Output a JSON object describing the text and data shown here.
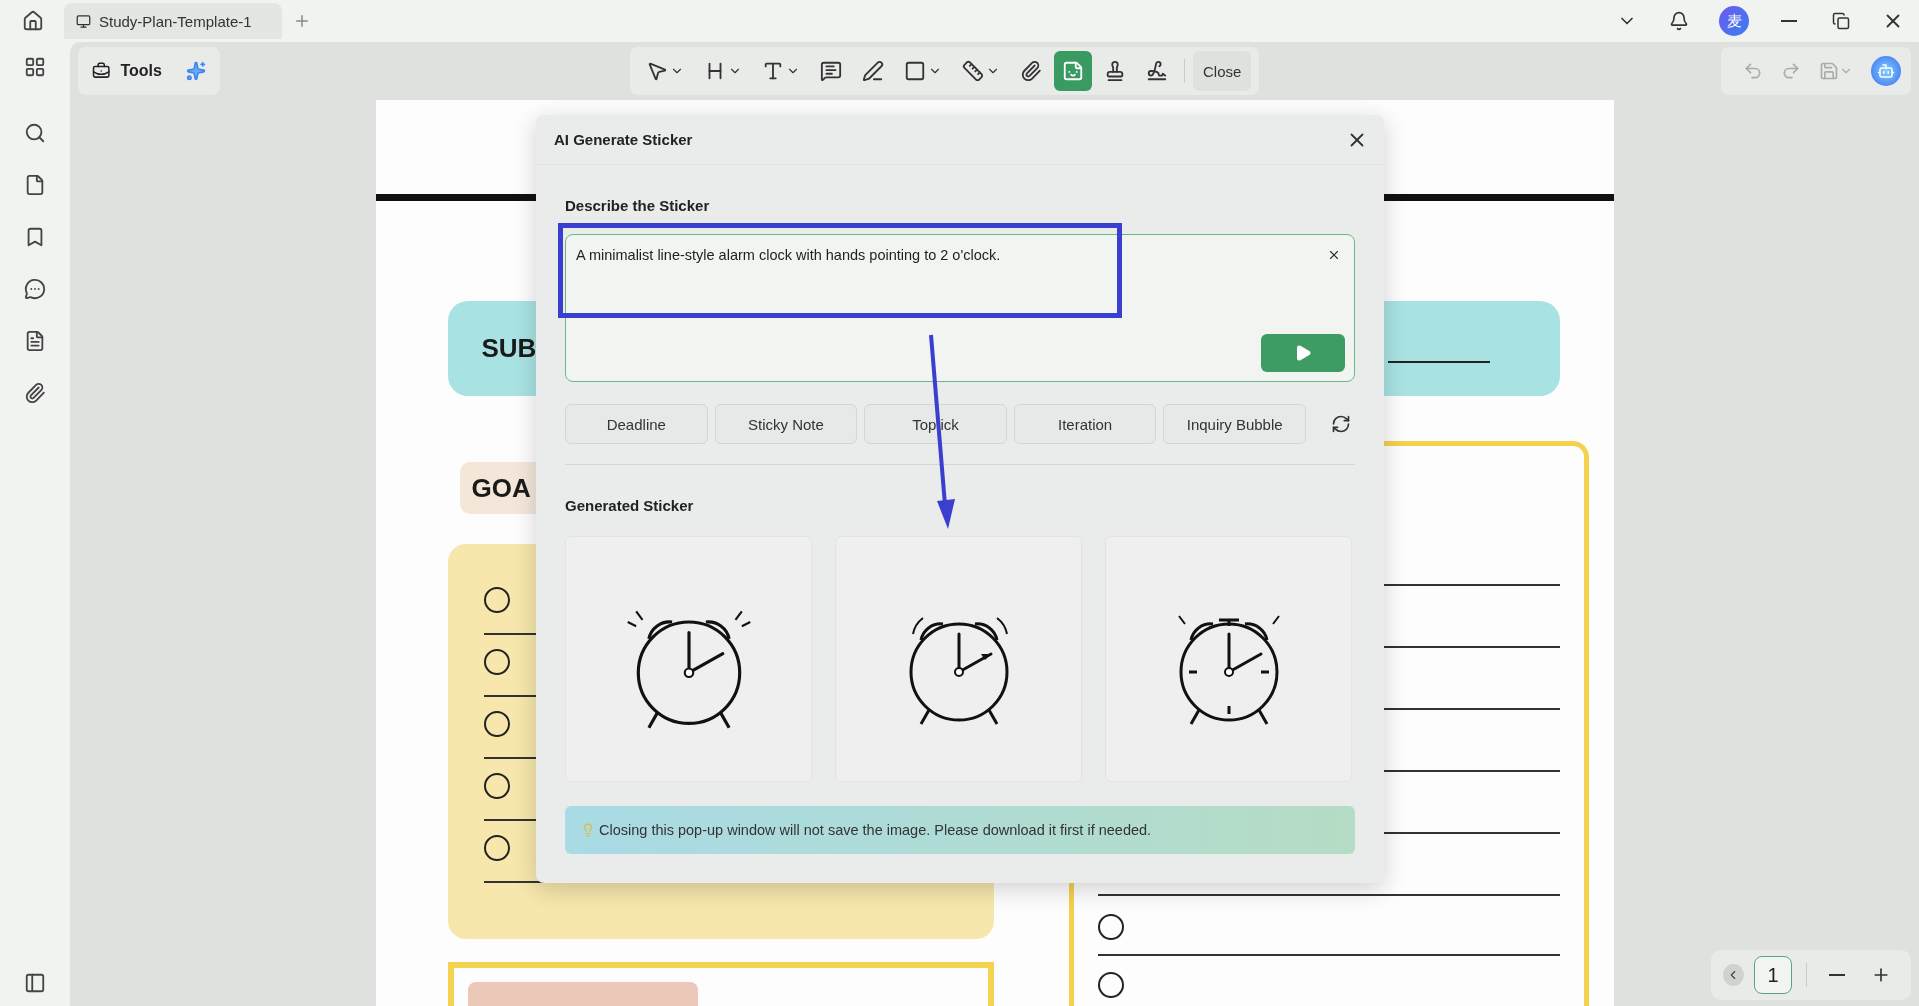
{
  "title_bar": {
    "tab_title": "Study-Plan-Template-1",
    "avatar_initial": "麦"
  },
  "tools_button": {
    "label": "Tools"
  },
  "toolbar": {
    "items": [
      {
        "selected": false,
        "kind": "menu"
      },
      {
        "selected": false,
        "kind": "menu"
      },
      {
        "selected": false,
        "kind": "menu"
      },
      {
        "selected": false,
        "kind": "plain"
      },
      {
        "selected": false,
        "kind": "plain"
      },
      {
        "selected": false,
        "kind": "menu"
      },
      {
        "selected": false,
        "kind": "menu"
      },
      {
        "selected": false,
        "kind": "plain"
      },
      {
        "selected": true,
        "kind": "plain"
      },
      {
        "selected": false,
        "kind": "plain"
      },
      {
        "selected": false,
        "kind": "plain"
      }
    ],
    "close_label": "Close"
  },
  "history_controls": [
    {
      "disabled": true
    },
    {
      "disabled": true
    },
    {
      "disabled": true
    }
  ],
  "document": {
    "subject_label": "SUB",
    "goals_label": "GOA",
    "goal_items": [
      {
        "checked": false
      },
      {
        "checked": false
      },
      {
        "checked": false
      },
      {
        "checked": false
      },
      {
        "checked": false
      }
    ],
    "right_items": [
      {
        "checked": false
      },
      {
        "checked": false
      }
    ]
  },
  "dialog": {
    "title": "AI Generate Sticker",
    "prompt_label": "Describe the Sticker",
    "prompt_value": "A minimalist line-style alarm clock with hands pointing to 2 o'clock.",
    "suggestions": [
      "Deadline",
      "Sticky Note",
      "Top ick",
      "Iteration",
      "Inquiry Bubble"
    ],
    "results_label": "Generated Sticker",
    "stickers": [
      {
        "kind": "classic"
      },
      {
        "kind": "ringing"
      },
      {
        "kind": "ticked"
      }
    ],
    "notice": "Closing this pop-up window will not save the image. Please download it first if needed."
  },
  "pager": {
    "page": "1"
  }
}
